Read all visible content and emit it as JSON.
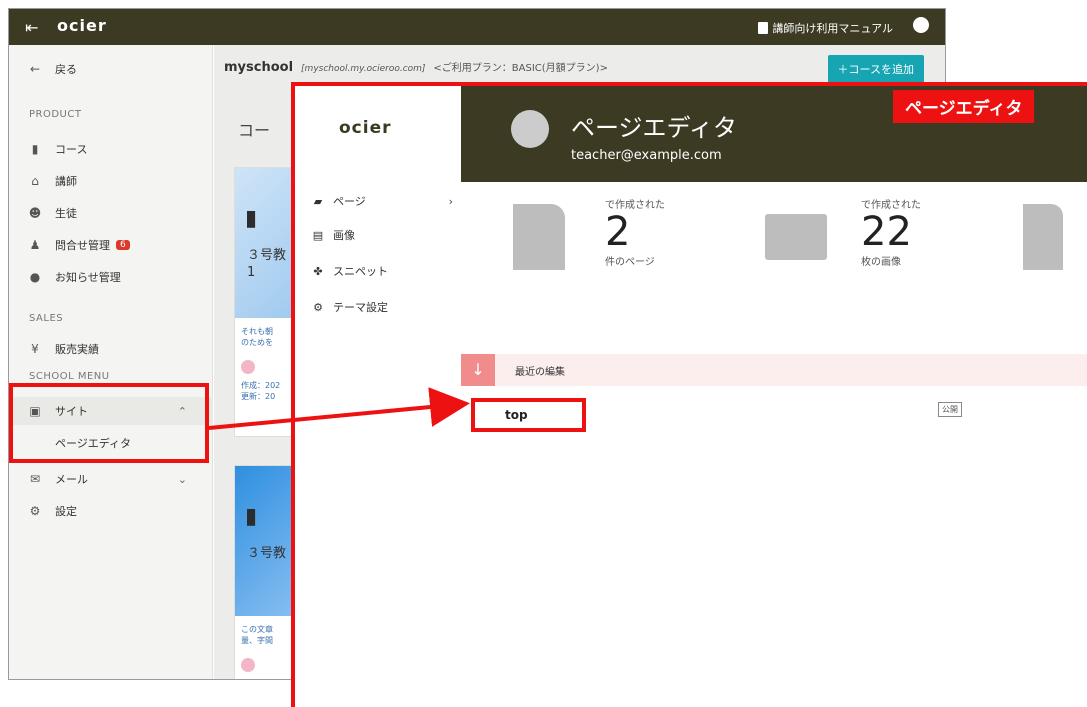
{
  "topbar": {
    "logo": "ocier",
    "manual_label": "講師向け利用マニュアル"
  },
  "sidebar": {
    "back": "戻る",
    "sections": {
      "product": "PRODUCT",
      "sales": "SALES",
      "school_menu": "SCHOOL MENU"
    },
    "items": {
      "course": "コース",
      "teacher": "講師",
      "student": "生徒",
      "inquiry": "問合せ管理",
      "inquiry_badge": "6",
      "news": "お知らせ管理",
      "sales_results": "販売実績",
      "site": "サイト",
      "page_editor": "ページエディタ",
      "mail": "メール",
      "settings": "設定"
    }
  },
  "main": {
    "school_name": "myschool",
    "school_url": "[myschool.my.ocieroo.com]",
    "plan": "<ご利用プラン：BASIC(月額プラン)>",
    "add_course": "＋コースを追加",
    "course_heading": "コー",
    "cards": [
      {
        "thumb_text": "３号教\n1",
        "desc": "それも朝\nのためを",
        "meta": "作成：202\n更新：20"
      },
      {
        "thumb_text": "３号教",
        "desc": "この文章\n量、字間",
        "meta": ""
      }
    ]
  },
  "callout": {
    "tag": "ページエディタ",
    "logo": "ocier",
    "nav": [
      "ページ",
      "画像",
      "スニペット",
      "テーマ設定"
    ],
    "header_title": "ページエディタ",
    "email": "teacher@example.com",
    "stats": [
      {
        "caption": "で作成された",
        "value": "2",
        "unit": "件のページ"
      },
      {
        "caption": "で作成された",
        "value": "22",
        "unit": "枚の画像"
      }
    ],
    "recent_label": "最近の編集",
    "recent_item": "top",
    "recent_status": "公開"
  },
  "colors": {
    "topbar": "#3d3a24",
    "accent_teal": "#17a4b3",
    "highlight_red": "#e11"
  }
}
